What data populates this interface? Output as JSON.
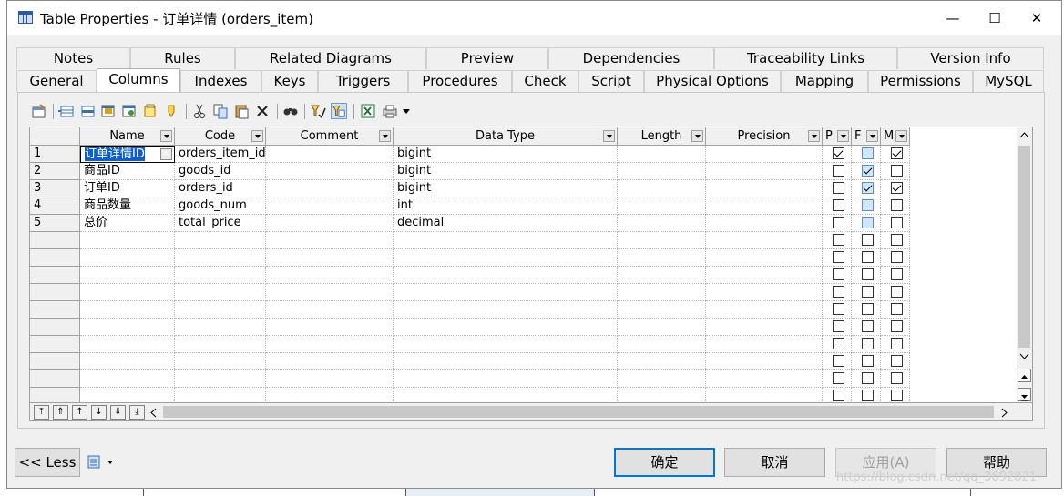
{
  "window": {
    "title": "Table Properties - 订单详情 (orders_item)",
    "minimize_glyph": "—",
    "maximize_glyph": "☐",
    "close_glyph": "✕"
  },
  "tabs": {
    "row1": [
      "Notes",
      "Rules",
      "Related Diagrams",
      "Preview",
      "Dependencies",
      "Traceability Links",
      "Version Info"
    ],
    "row2": [
      "General",
      "Columns",
      "Indexes",
      "Keys",
      "Triggers",
      "Procedures",
      "Check",
      "Script",
      "Physical Options",
      "Mapping",
      "Permissions",
      "MySQL"
    ],
    "active": "Columns"
  },
  "toolbar": {
    "icons": [
      "properties-icon",
      "add-row-icon",
      "insert-row-icon",
      "add-attributes-icon",
      "reuse-columns-icon",
      "new-domain-icon",
      "cut-icon",
      "copy-icon",
      "paste-icon",
      "delete-icon",
      "find-icon",
      "filter-icon",
      "customize-columns-icon",
      "excel-export-icon",
      "print-icon"
    ]
  },
  "grid": {
    "headers": [
      "Name",
      "Code",
      "Comment",
      "Data Type",
      "Length",
      "Precision",
      "P",
      "F",
      "M"
    ],
    "rows": [
      {
        "num": "1",
        "name": "订单详情ID",
        "code": "orders_item_id",
        "comment": "",
        "type": "bigint",
        "length": "",
        "precision": "",
        "p": true,
        "f": false,
        "m": true
      },
      {
        "num": "2",
        "name": "商品ID",
        "code": "goods_id",
        "comment": "",
        "type": "bigint",
        "length": "",
        "precision": "",
        "p": false,
        "f": true,
        "m": false
      },
      {
        "num": "3",
        "name": "订单ID",
        "code": "orders_id",
        "comment": "",
        "type": "bigint",
        "length": "",
        "precision": "",
        "p": false,
        "f": true,
        "m": true
      },
      {
        "num": "4",
        "name": "商品数量",
        "code": "goods_num",
        "comment": "",
        "type": "int",
        "length": "",
        "precision": "",
        "p": false,
        "f": false,
        "m": false
      },
      {
        "num": "5",
        "name": "总价",
        "code": "total_price",
        "comment": "",
        "type": "decimal",
        "length": "",
        "precision": "",
        "p": false,
        "f": false,
        "m": false
      }
    ],
    "empty_row_count": 10,
    "nav_buttons": [
      "move-top-icon",
      "move-page-up-icon",
      "move-up-icon",
      "move-down-icon",
      "move-page-down-icon",
      "move-bottom-icon"
    ]
  },
  "buttons": {
    "less": "<< Less",
    "ok": "确定",
    "cancel": "取消",
    "apply": "应用(A)",
    "help": "帮助"
  },
  "watermark": "https://blog.csdn.net/qq_3692821"
}
